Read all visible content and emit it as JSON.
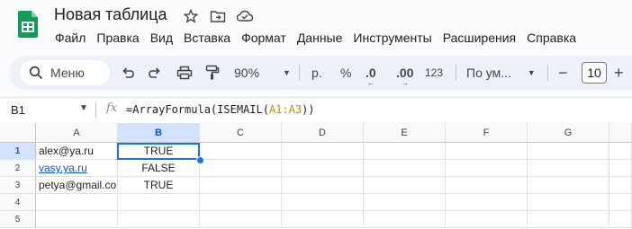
{
  "app": {
    "title": "Новая таблица",
    "accent": "#0f9d58"
  },
  "menu": [
    "Файл",
    "Правка",
    "Вид",
    "Вставка",
    "Формат",
    "Данные",
    "Инструменты",
    "Расширения",
    "Справка"
  ],
  "toolbar": {
    "search_label": "Меню",
    "zoom": "90%",
    "currency": "р.",
    "percent": "%",
    "dec_decrease": ".0",
    "dec_increase": ".00",
    "number_format": "123",
    "font": "По ум...",
    "font_size": "10",
    "minus": "−",
    "plus": "+"
  },
  "formula_bar": {
    "cell_ref": "B1",
    "fx": "fx",
    "formula_prefix": "=ArrayFormula(ISEMAIL(",
    "formula_range": "A1:A3",
    "formula_suffix": "))"
  },
  "sheet": {
    "columns": [
      "A",
      "B",
      "C",
      "D",
      "E",
      "F",
      "G"
    ],
    "rows": [
      "1",
      "2",
      "3",
      "4",
      "5"
    ],
    "cells": {
      "a1": "alex@ya.ru",
      "a2": "vasy.ya.ru",
      "a3": "petya@gmail.com",
      "b1": "TRUE",
      "b2": "FALSE",
      "b3": "TRUE"
    }
  }
}
